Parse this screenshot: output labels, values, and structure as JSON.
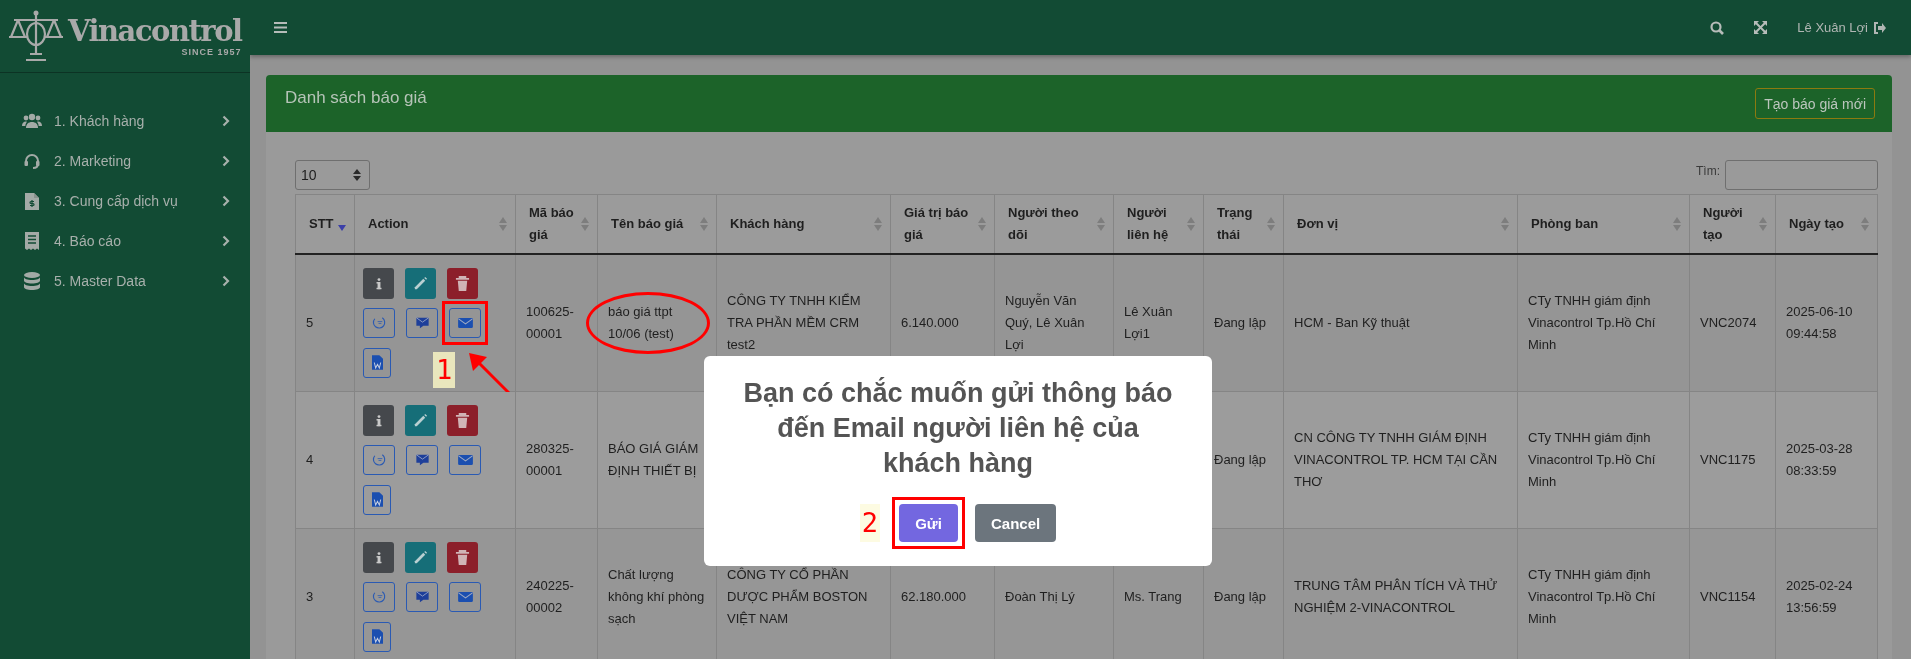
{
  "sidebar": {
    "logo": {
      "name": "Vinacontrol",
      "tagline": "SINCE 1957"
    },
    "items": [
      {
        "label": "1. Khách hàng",
        "kind": "users"
      },
      {
        "label": "2. Marketing",
        "kind": "headset"
      },
      {
        "label": "3. Cung cấp dịch vụ",
        "kind": "invoice"
      },
      {
        "label": "4. Báo cáo",
        "kind": "receipt"
      },
      {
        "label": "5. Master Data",
        "kind": "database"
      }
    ]
  },
  "topbar": {
    "user": "Lê Xuân Lợi"
  },
  "panel": {
    "title": "Danh sách báo giá",
    "new_button": "Tạo báo giá mới",
    "page_size": "10",
    "search_label": "Tìm:"
  },
  "table": {
    "columns": [
      {
        "label": "STT",
        "sorted_descending": true
      },
      {
        "label": "Action",
        "sorted_descending": false
      },
      {
        "label": "Mã báo giá",
        "sorted_descending": false
      },
      {
        "label": "Tên báo giá",
        "sorted_descending": false
      },
      {
        "label": "Khách hàng",
        "sorted_descending": false
      },
      {
        "label": "Giá trị báo giá",
        "sorted_descending": false
      },
      {
        "label": "Người theo dõi",
        "sorted_descending": false
      },
      {
        "label": "Người liên hệ",
        "sorted_descending": false
      },
      {
        "label": "Trạng thái",
        "sorted_descending": false
      },
      {
        "label": "Đơn vị",
        "sorted_descending": false
      },
      {
        "label": "Phòng ban",
        "sorted_descending": false
      },
      {
        "label": "Người tạo",
        "sorted_descending": false
      },
      {
        "label": "Ngày tạo",
        "sorted_descending": false
      }
    ],
    "action_buttons": [
      {
        "kind": "info"
      },
      {
        "kind": "edit"
      },
      {
        "kind": "delete"
      },
      {
        "kind": "zalo"
      },
      {
        "kind": "sms"
      },
      {
        "kind": "email"
      },
      {
        "kind": "word"
      }
    ],
    "rows": [
      {
        "stt": "5",
        "code": "100625-00001",
        "name": "báo giá ttpt 10/06 (test)",
        "customer": "CÔNG TY TNHH KIỂM TRA PHẦN MỀM CRM test2",
        "value": "6.140.000",
        "follower": "Nguyễn Văn Quý, Lê Xuân Lợi",
        "contact": "Lê Xuân Lợi1",
        "status": "Đang lập",
        "unit": "HCM - Ban Kỹ thuật",
        "department": "CTy TNHH giám định Vinacontrol Tp.Hồ Chí Minh",
        "creator": "VNC2074",
        "created": "2025-06-10 09:44:58",
        "name_circled": true,
        "email_highlighted": true,
        "step": "1"
      },
      {
        "stt": "4",
        "code": "280325-00001",
        "name": "BÁO GIÁ GIÁM ĐỊNH THIẾT BỊ",
        "status": "Đang lập",
        "unit": "CN CÔNG TY TNHH GIÁM ĐỊNH VINACONTROL TP. HCM TẠI CẦN THƠ",
        "department": "CTy TNHH giám định Vinacontrol Tp.Hồ Chí Minh",
        "creator": "VNC1175",
        "created": "2025-03-28 08:33:59",
        "name_circled": false,
        "email_highlighted": false
      },
      {
        "stt": "3",
        "code": "240225-00002",
        "name": "Chất lượng không khí phòng sạch",
        "customer": "CÔNG TY CỔ PHẦN DƯỢC PHẨM BOSTON VIỆT NAM",
        "value": "62.180.000",
        "follower": "Đoàn Thị Lý",
        "contact": "Ms. Trang",
        "status": "Đang lập",
        "unit": "TRUNG TÂM PHÂN TÍCH VÀ THỬ NGHIỆM 2-VINACONTROL",
        "department": "CTy TNHH giám định Vinacontrol Tp.Hồ Chí Minh",
        "creator": "VNC1154",
        "created": "2025-02-24 13:56:59",
        "name_circled": false,
        "email_highlighted": false
      }
    ]
  },
  "dialog": {
    "message": "Bạn có chắc muốn gửi thông báo đến Email người liên hệ của khách hàng",
    "buttons": [
      {
        "label": "Gửi",
        "kind": "confirm",
        "highlighted": true,
        "step": "2"
      },
      {
        "label": "Cancel",
        "kind": "cancel",
        "highlighted": false
      }
    ]
  }
}
